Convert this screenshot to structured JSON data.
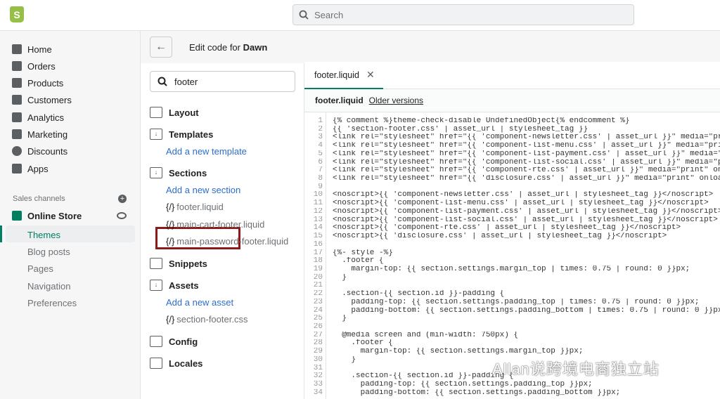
{
  "topbar": {
    "search_placeholder": "Search",
    "logo": "S"
  },
  "nav": {
    "items": [
      "Home",
      "Orders",
      "Products",
      "Customers",
      "Analytics",
      "Marketing",
      "Discounts",
      "Apps"
    ],
    "sales_channels": "Sales channels",
    "online_store": "Online Store",
    "sub": [
      "Themes",
      "Blog posts",
      "Pages",
      "Navigation",
      "Preferences"
    ]
  },
  "header": {
    "title_prefix": "Edit code for ",
    "theme": "Dawn"
  },
  "tree": {
    "search_value": "footer",
    "layout": "Layout",
    "templates": "Templates",
    "add_template": "Add a new template",
    "sections": "Sections",
    "add_section": "Add a new section",
    "section_files": [
      "footer.liquid",
      "main-cart-footer.liquid",
      "main-password-footer.liquid"
    ],
    "snippets": "Snippets",
    "assets": "Assets",
    "add_asset": "Add a new asset",
    "asset_files": [
      "section-footer.css"
    ],
    "config": "Config",
    "locales": "Locales"
  },
  "editor": {
    "tab": "footer.liquid",
    "file": "footer.liquid",
    "older": "Older versions",
    "lines": [
      "{% comment %}theme-check-disable UndefinedObject{% endcomment %}",
      "{{ 'section-footer.css' | asset_url | stylesheet_tag }}",
      "<link rel=\"stylesheet\" href=\"{{ 'component-newsletter.css' | asset_url }}\" media=\"print\" onload=\"this.media='all'\">",
      "<link rel=\"stylesheet\" href=\"{{ 'component-list-menu.css' | asset_url }}\" media=\"print\" onload=\"this.media='all'\">",
      "<link rel=\"stylesheet\" href=\"{{ 'component-list-payment.css' | asset_url }}\" media=\"print\" onload=\"this.media='all'\">",
      "<link rel=\"stylesheet\" href=\"{{ 'component-list-social.css' | asset_url }}\" media=\"print\" onload=\"this.media='all'\">",
      "<link rel=\"stylesheet\" href=\"{{ 'component-rte.css' | asset_url }}\" media=\"print\" onload=\"this.media='all'\">",
      "<link rel=\"stylesheet\" href=\"{{ 'disclosure.css' | asset_url }}\" media=\"print\" onload=\"this.media='all'\">",
      "",
      "<noscript>{{ 'component-newsletter.css' | asset_url | stylesheet_tag }}</noscript>",
      "<noscript>{{ 'component-list-menu.css' | asset_url | stylesheet_tag }}</noscript>",
      "<noscript>{{ 'component-list-payment.css' | asset_url | stylesheet_tag }}</noscript>",
      "<noscript>{{ 'component-list-social.css' | asset_url | stylesheet_tag }}</noscript>",
      "<noscript>{{ 'component-rte.css' | asset_url | stylesheet_tag }}</noscript>",
      "<noscript>{{ 'disclosure.css' | asset_url | stylesheet_tag }}</noscript>",
      "",
      "{%- style -%}",
      "  .footer {",
      "    margin-top: {{ section.settings.margin_top | times: 0.75 | round: 0 }}px;",
      "  }",
      "",
      "  .section-{{ section.id }}-padding {",
      "    padding-top: {{ section.settings.padding_top | times: 0.75 | round: 0 }}px;",
      "    padding-bottom: {{ section.settings.padding_bottom | times: 0.75 | round: 0 }}px;",
      "  }",
      "",
      "  @media screen and (min-width: 750px) {",
      "    .footer {",
      "      margin-top: {{ section.settings.margin_top }}px;",
      "    }",
      "",
      "    .section-{{ section.id }}-padding {",
      "      padding-top: {{ section.settings.padding_top }}px;",
      "      padding-bottom: {{ section.settings.padding_bottom }}px;"
    ]
  },
  "watermark": "Allan说跨境电商独立站"
}
